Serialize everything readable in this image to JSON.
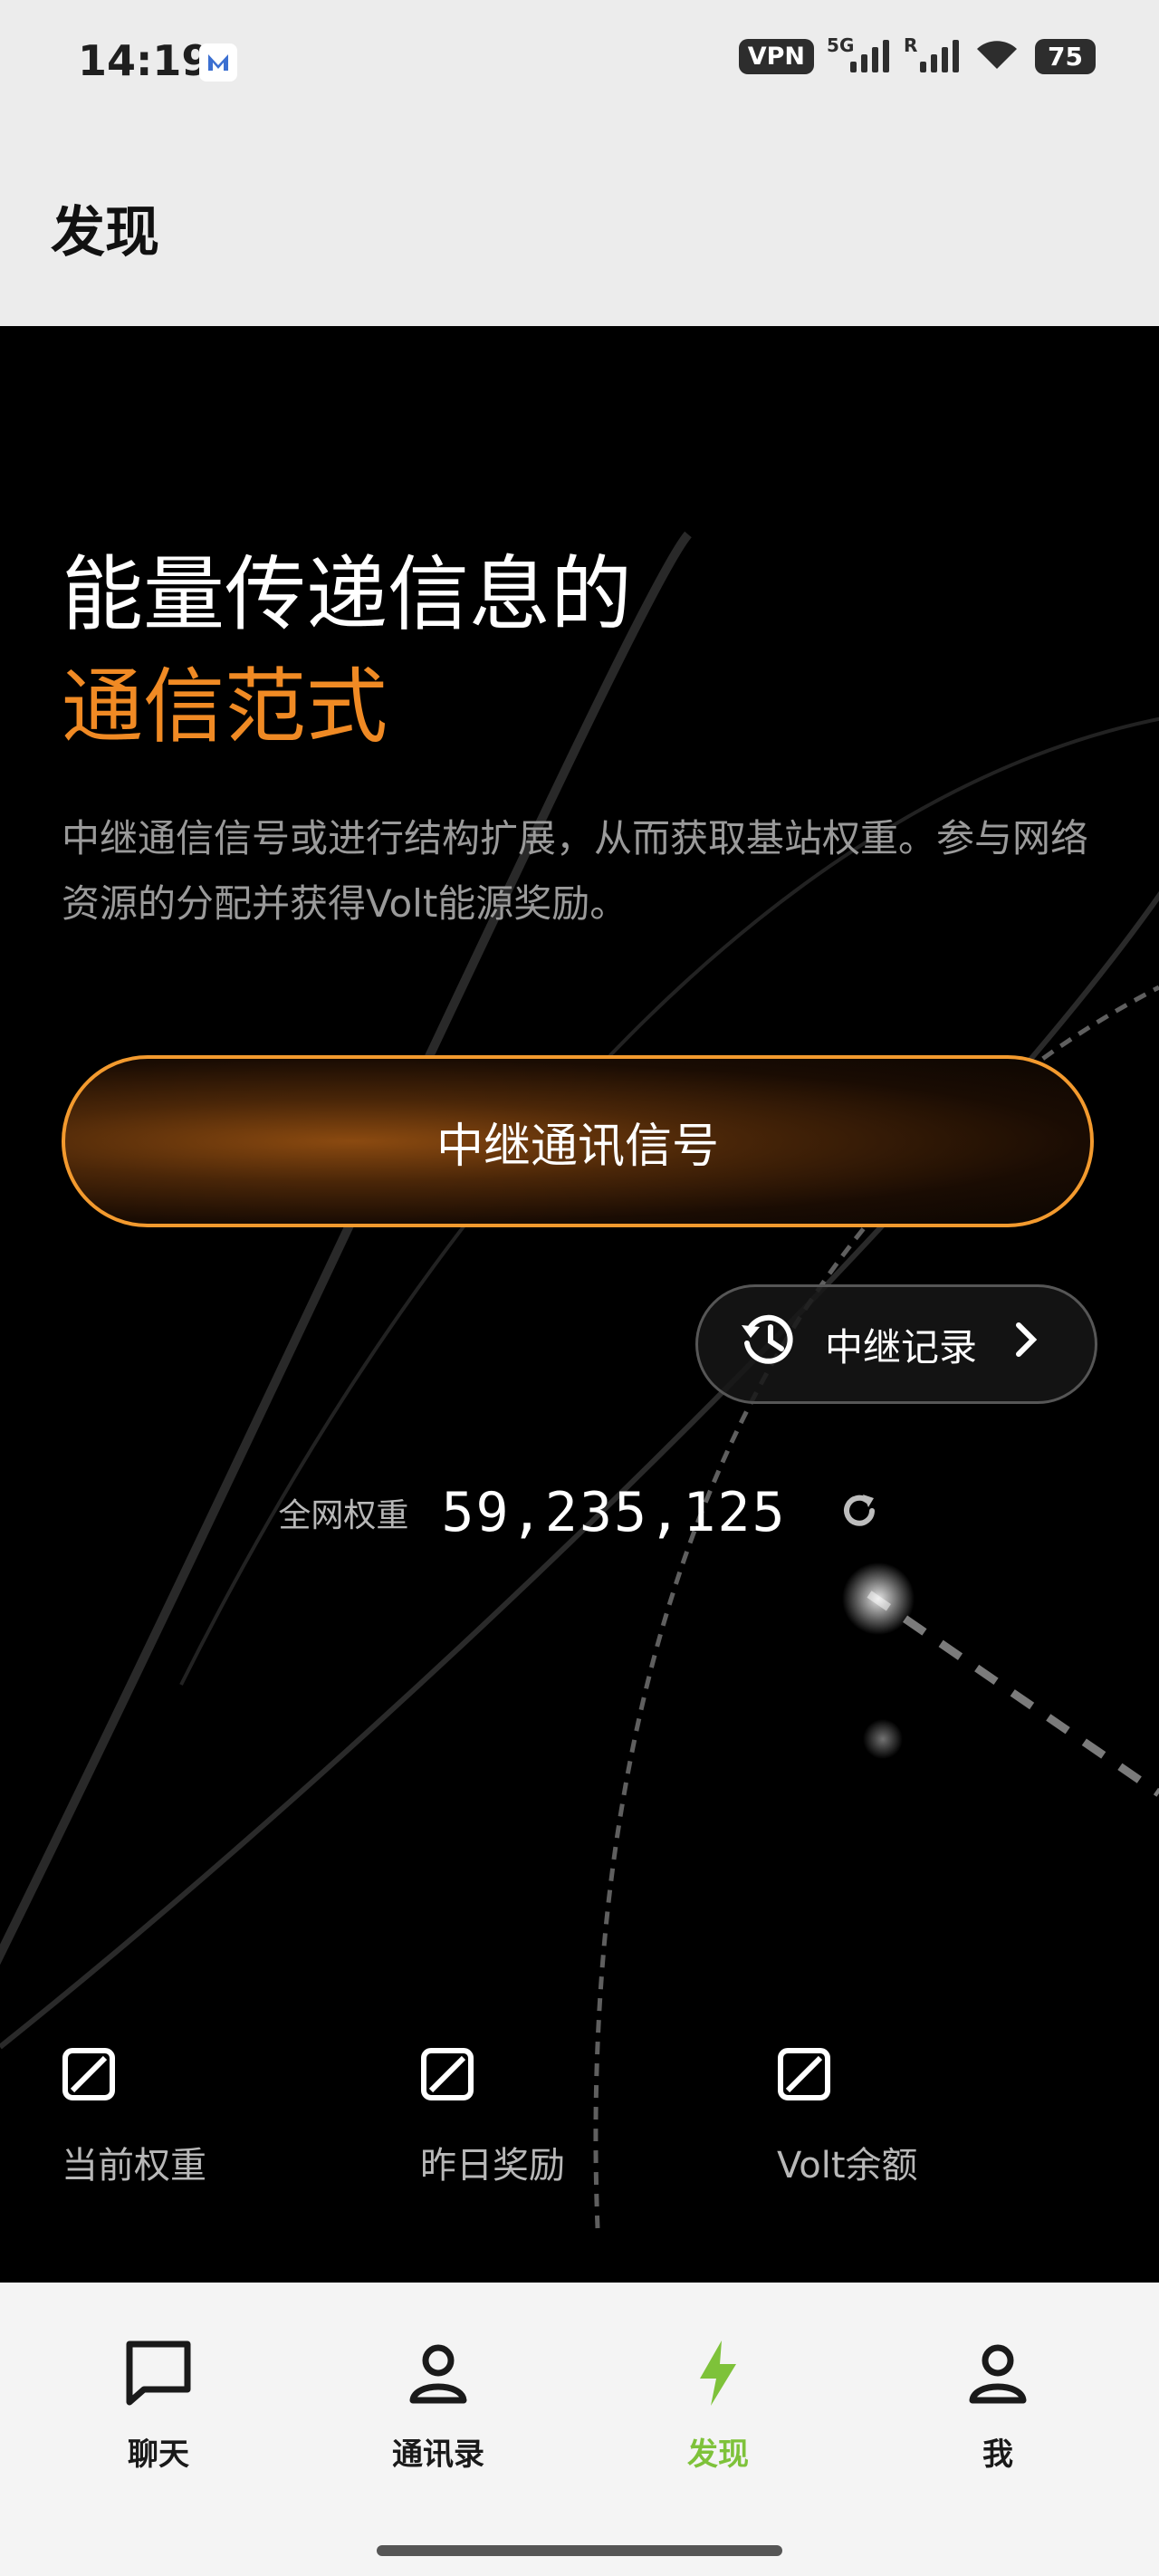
{
  "status": {
    "time": "14:19",
    "vpn": "VPN",
    "net": "5G",
    "roam": "R",
    "battery": "75"
  },
  "header": {
    "title": "发现"
  },
  "hero": {
    "headline_line1": "能量传递信息的",
    "headline_line2": "通信范式",
    "description": "中继通信信号或进行结构扩展，从而获取基站权重。参与网络资源的分配并获得Volt能源奖励。",
    "relay_button": "中继通讯信号",
    "record_button": "中继记录",
    "network_weight_label": "全网权重",
    "network_weight_value": "59,235,125"
  },
  "stats": [
    {
      "label": "当前权重",
      "icon": "slash-box-icon"
    },
    {
      "label": "昨日奖励",
      "icon": "slash-box-icon"
    },
    {
      "label": "Volt余额",
      "icon": "slash-box-icon"
    }
  ],
  "tabs": [
    {
      "label": "聊天",
      "icon": "chat-icon"
    },
    {
      "label": "通讯录",
      "icon": "person-icon"
    },
    {
      "label": "发现",
      "icon": "lightning-icon",
      "active": true
    },
    {
      "label": "我",
      "icon": "person-icon"
    }
  ],
  "colors": {
    "accent": "#f08a24",
    "active_tab": "#7ec23a"
  }
}
